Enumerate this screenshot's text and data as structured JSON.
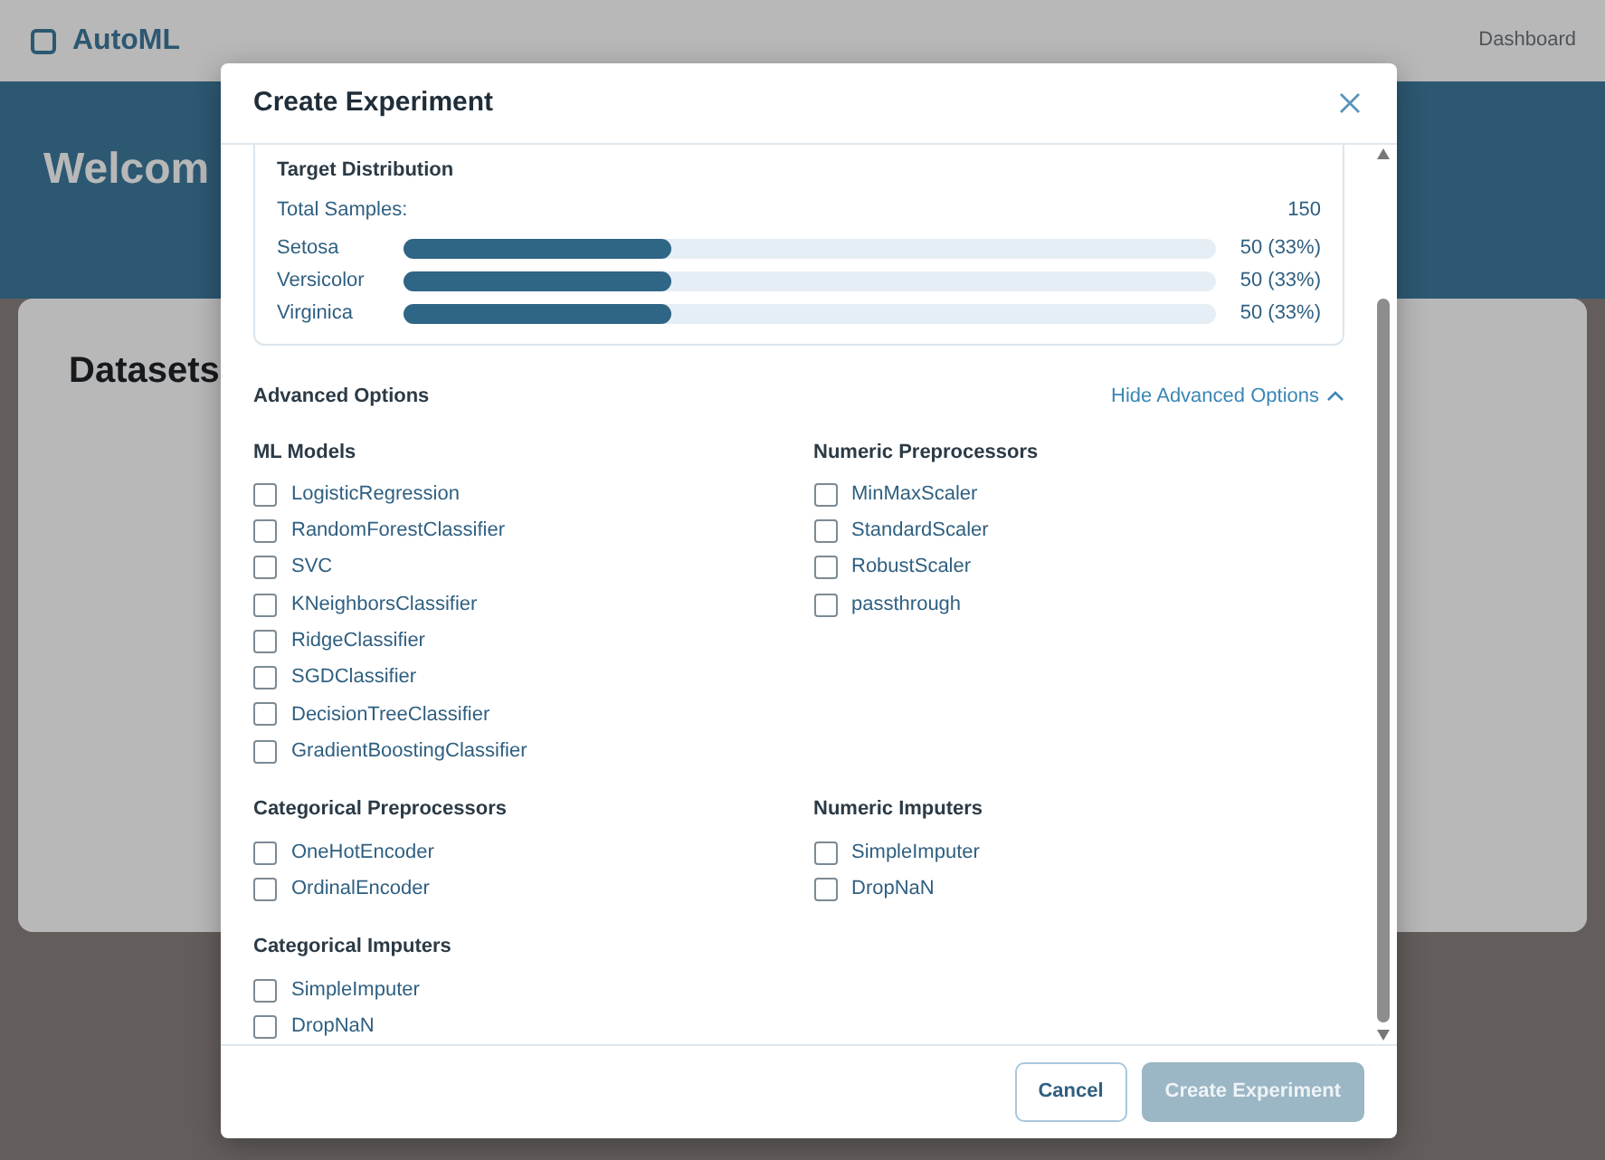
{
  "background": {
    "brand": "AutoML",
    "nav_link": "Dashboard",
    "hero_title": "Welcom",
    "section_title": "Datasets"
  },
  "modal": {
    "title": "Create Experiment",
    "target_distribution": {
      "title": "Target Distribution",
      "total_label": "Total Samples:",
      "total_value": "150",
      "classes": [
        {
          "name": "Setosa",
          "level": 0.33,
          "reading": "50 (33%)"
        },
        {
          "name": "Versicolor",
          "level": 0.33,
          "reading": "50 (33%)"
        },
        {
          "name": "Virginica",
          "level": 0.33,
          "reading": "50 (33%)"
        }
      ]
    },
    "advanced": {
      "title": "Advanced Options",
      "toggle": "Hide Advanced Options",
      "expanded": true,
      "groups": [
        {
          "title": "ML Models",
          "options": [
            {
              "label": "LogisticRegression",
              "checked": false
            },
            {
              "label": "RandomForestClassifier",
              "checked": false
            },
            {
              "label": "SVC",
              "checked": false
            },
            {
              "label": "KNeighborsClassifier",
              "checked": false
            },
            {
              "label": "RidgeClassifier",
              "checked": false
            },
            {
              "label": "SGDClassifier",
              "checked": false
            },
            {
              "label": "DecisionTreeClassifier",
              "checked": false
            },
            {
              "label": "GradientBoostingClassifier",
              "checked": false
            }
          ]
        },
        {
          "title": "Numeric Preprocessors",
          "options": [
            {
              "label": "MinMaxScaler",
              "checked": false
            },
            {
              "label": "StandardScaler",
              "checked": false
            },
            {
              "label": "RobustScaler",
              "checked": false
            },
            {
              "label": "passthrough",
              "checked": false
            }
          ]
        },
        {
          "title": "Categorical Preprocessors",
          "options": [
            {
              "label": "OneHotEncoder",
              "checked": false
            },
            {
              "label": "OrdinalEncoder",
              "checked": false
            }
          ]
        },
        {
          "title": "Numeric Imputers",
          "options": [
            {
              "label": "SimpleImputer",
              "checked": false
            },
            {
              "label": "DropNaN",
              "checked": false
            }
          ]
        },
        {
          "title": "Categorical Imputers",
          "options": [
            {
              "label": "SimpleImputer",
              "checked": false
            },
            {
              "label": "DropNaN",
              "checked": false
            }
          ]
        }
      ]
    },
    "buttons": [
      {
        "label": "Cancel",
        "kind": "secondary",
        "disabled": false
      },
      {
        "label": "Create Experiment",
        "kind": "primary",
        "disabled": true
      }
    ]
  }
}
